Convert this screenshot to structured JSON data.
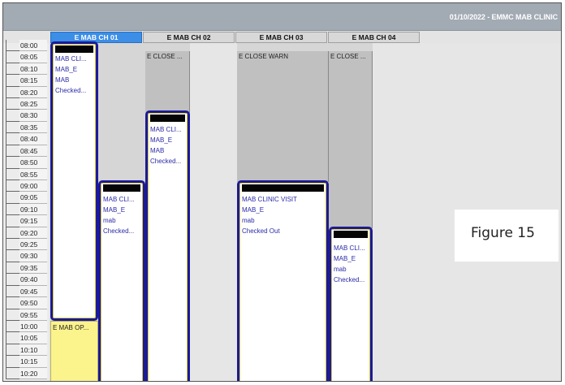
{
  "window": {
    "title": "01/10/2022 - EMMC MAB CLINIC"
  },
  "columns": [
    {
      "label": "E MAB CH 01",
      "selected": true
    },
    {
      "label": "E MAB CH 02",
      "selected": false
    },
    {
      "label": "E MAB CH 03",
      "selected": false
    },
    {
      "label": "E MAB CH 04",
      "selected": false
    }
  ],
  "time_slots": [
    "08:00",
    "08:05",
    "08:10",
    "08:15",
    "08:20",
    "08:25",
    "08:30",
    "08:35",
    "08:40",
    "08:45",
    "08:50",
    "08:55",
    "09:00",
    "09:05",
    "09:10",
    "09:15",
    "09:20",
    "09:25",
    "09:30",
    "09:35",
    "09:40",
    "09:45",
    "09:50",
    "09:55",
    "10:00",
    "10:05",
    "10:10",
    "10:15",
    "10:20"
  ],
  "blocks": {
    "ch02_close": "E CLOSE ...",
    "ch03_close": "E CLOSE WARN",
    "ch04_close": "E CLOSE ...",
    "ch01_yellow": "E MAB OP..."
  },
  "appointments": {
    "ch01_a": [
      "MAB CLI...",
      "MAB_E",
      "MAB",
      "Checked..."
    ],
    "ch01_b": [
      "MAB CLI...",
      "MAB_E",
      "mab",
      "Checked..."
    ],
    "ch02_a": [
      "MAB CLI...",
      "MAB_E",
      "MAB",
      "Checked..."
    ],
    "ch03_a": [
      "MAB CLINIC VISIT",
      "MAB_E",
      "mab",
      "Checked Out"
    ],
    "ch04_a": [
      "MAB CLI...",
      "MAB_E",
      "mab",
      "Checked..."
    ]
  },
  "caption": "Figure 15",
  "colors": {
    "selected_header": "#3c8ee6",
    "appt_border": "#1a1a9a",
    "appt_text": "#2a2aa8",
    "close_block": "#c0c0c0",
    "op_block": "#fbf38c"
  }
}
